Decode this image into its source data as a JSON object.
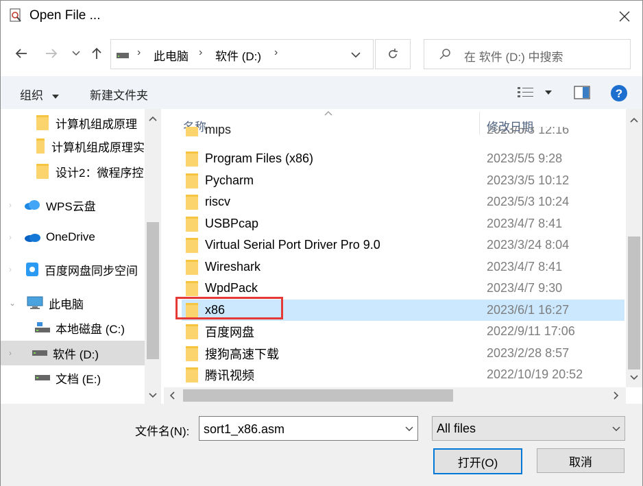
{
  "window": {
    "title": "Open File ..."
  },
  "address": {
    "breadcrumb": [
      "此电脑",
      "软件 (D:)"
    ]
  },
  "search": {
    "placeholder": "在 软件 (D:) 中搜索"
  },
  "toolbar": {
    "organize_label": "组织",
    "new_folder_label": "新建文件夹"
  },
  "sidebar": {
    "items": [
      {
        "label": "计算机组成原理",
        "icon": "folder-icon"
      },
      {
        "label": "计算机组成原理实",
        "icon": "folder-icon"
      },
      {
        "label": "设计2：微程序控",
        "icon": "folder-icon"
      },
      {
        "label": "WPS云盘",
        "icon": "cloud-icon"
      },
      {
        "label": "OneDrive",
        "icon": "onedrive-icon"
      },
      {
        "label": "百度网盘同步空间",
        "icon": "baidu-icon"
      },
      {
        "label": "此电脑",
        "icon": "pc-icon"
      },
      {
        "label": "本地磁盘 (C:)",
        "icon": "drive-icon"
      },
      {
        "label": "软件 (D:)",
        "icon": "drive-icon"
      },
      {
        "label": "文档 (E:)",
        "icon": "drive-icon"
      }
    ]
  },
  "file_list": {
    "columns": {
      "name": "名称",
      "date": "修改日期"
    },
    "rows": [
      {
        "name": "mips",
        "date": "2023/5/3 12:16"
      },
      {
        "name": "Program Files (x86)",
        "date": "2023/5/5 9:28"
      },
      {
        "name": "Pycharm",
        "date": "2023/3/5 10:12"
      },
      {
        "name": "riscv",
        "date": "2023/5/3 10:24"
      },
      {
        "name": "USBPcap",
        "date": "2023/4/7 8:41"
      },
      {
        "name": "Virtual Serial Port Driver Pro 9.0",
        "date": "2023/3/24 8:04"
      },
      {
        "name": "Wireshark",
        "date": "2023/4/7 8:41"
      },
      {
        "name": "WpdPack",
        "date": "2023/4/7 9:30"
      },
      {
        "name": "x86",
        "date": "2023/6/1 16:27"
      },
      {
        "name": "百度网盘",
        "date": "2022/9/11 17:06"
      },
      {
        "name": "搜狗高速下载",
        "date": "2023/2/28 8:57"
      },
      {
        "name": "腾讯视频",
        "date": "2022/10/19 20:52"
      }
    ]
  },
  "footer": {
    "filename_label": "文件名(N):",
    "filename_value": "sort1_x86.asm",
    "filter_value": "All files",
    "open_label": "打开(O)",
    "cancel_label": "取消"
  },
  "colors": {
    "selection": "#cce8ff",
    "highlight_box": "#e53935",
    "accent": "#0078d7"
  }
}
